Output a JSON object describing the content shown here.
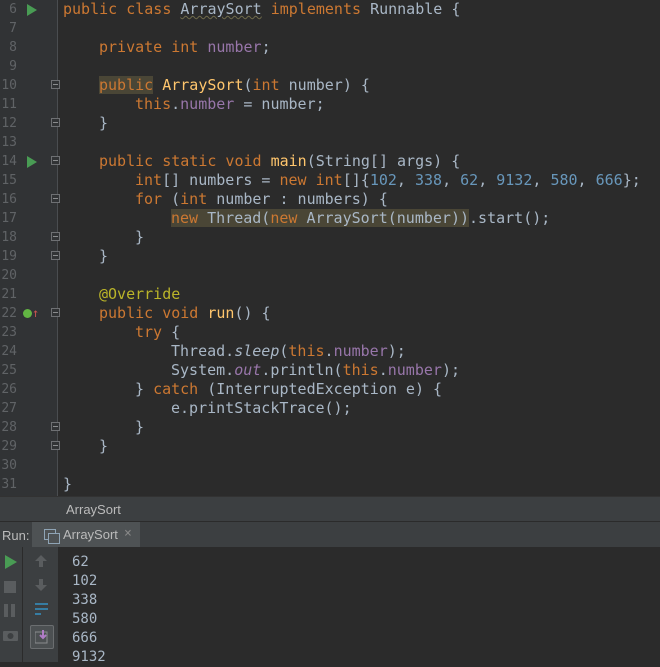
{
  "editor": {
    "lines": [
      {
        "n": "6",
        "indent": 0,
        "run": true,
        "tokens": [
          [
            "kw",
            "public class "
          ],
          [
            "cls",
            "ArraySort"
          ],
          [
            "kw",
            " implements "
          ],
          [
            "txt",
            "Runnable {"
          ]
        ]
      },
      {
        "n": "7",
        "indent": 0,
        "tokens": []
      },
      {
        "n": "8",
        "indent": 4,
        "tokens": [
          [
            "kw",
            "private int "
          ],
          [
            "fld",
            "number"
          ],
          [
            "txt",
            ";"
          ]
        ]
      },
      {
        "n": "9",
        "indent": 0,
        "tokens": []
      },
      {
        "n": "10",
        "indent": 4,
        "fold": true,
        "tokens": [
          [
            "kw",
            "public",
            "hl"
          ],
          [
            "txt",
            " "
          ],
          [
            "fn",
            "ArraySort"
          ],
          [
            "txt",
            "("
          ],
          [
            "kw",
            "int"
          ],
          [
            "txt",
            " number) {"
          ]
        ]
      },
      {
        "n": "11",
        "indent": 8,
        "tokens": [
          [
            "kw",
            "this"
          ],
          [
            "txt",
            "."
          ],
          [
            "fld",
            "number"
          ],
          [
            "txt",
            " = number;"
          ]
        ]
      },
      {
        "n": "12",
        "indent": 4,
        "fold": true,
        "tokens": [
          [
            "txt",
            "}"
          ]
        ]
      },
      {
        "n": "13",
        "indent": 0,
        "tokens": []
      },
      {
        "n": "14",
        "indent": 4,
        "run": true,
        "fold": true,
        "tokens": [
          [
            "kw",
            "public static void "
          ],
          [
            "fn",
            "main"
          ],
          [
            "txt",
            "(String[] args) {"
          ]
        ]
      },
      {
        "n": "15",
        "indent": 8,
        "tokens": [
          [
            "kw",
            "int"
          ],
          [
            "txt",
            "[] numbers = "
          ],
          [
            "kw",
            "new int"
          ],
          [
            "txt",
            "[]{"
          ],
          [
            "num",
            "102"
          ],
          [
            "txt",
            ", "
          ],
          [
            "num",
            "338"
          ],
          [
            "txt",
            ", "
          ],
          [
            "num",
            "62"
          ],
          [
            "txt",
            ", "
          ],
          [
            "num",
            "9132"
          ],
          [
            "txt",
            ", "
          ],
          [
            "num",
            "580"
          ],
          [
            "txt",
            ", "
          ],
          [
            "num",
            "666"
          ],
          [
            "txt",
            "};"
          ]
        ]
      },
      {
        "n": "16",
        "indent": 8,
        "fold": true,
        "tokens": [
          [
            "kw",
            "for"
          ],
          [
            "txt",
            " ("
          ],
          [
            "kw",
            "int"
          ],
          [
            "txt",
            " number : numbers) {"
          ]
        ]
      },
      {
        "n": "17",
        "indent": 12,
        "tokens": [
          [
            "kw",
            "new ",
            "hl"
          ],
          [
            "txt",
            "Thread(",
            "hl"
          ],
          [
            "kw",
            "new ",
            "hl"
          ],
          [
            "txt",
            "ArraySort(number))",
            "hl"
          ],
          [
            "txt",
            ".start();"
          ]
        ]
      },
      {
        "n": "18",
        "indent": 8,
        "fold": true,
        "tokens": [
          [
            "txt",
            "}"
          ]
        ]
      },
      {
        "n": "19",
        "indent": 4,
        "fold": true,
        "tokens": [
          [
            "txt",
            "}"
          ]
        ]
      },
      {
        "n": "20",
        "indent": 0,
        "tokens": []
      },
      {
        "n": "21",
        "indent": 4,
        "tokens": [
          [
            "ann",
            "@Override"
          ]
        ]
      },
      {
        "n": "22",
        "indent": 4,
        "override": true,
        "fold": true,
        "tokens": [
          [
            "kw",
            "public void "
          ],
          [
            "fn",
            "run"
          ],
          [
            "txt",
            "() {"
          ]
        ]
      },
      {
        "n": "23",
        "indent": 8,
        "tokens": [
          [
            "kw",
            "try"
          ],
          [
            "txt",
            " {"
          ]
        ]
      },
      {
        "n": "24",
        "indent": 12,
        "tokens": [
          [
            "txt",
            "Thread."
          ],
          [
            "it",
            "sleep"
          ],
          [
            "txt",
            "("
          ],
          [
            "kw",
            "this"
          ],
          [
            "txt",
            "."
          ],
          [
            "fld",
            "number"
          ],
          [
            "txt",
            ");"
          ]
        ]
      },
      {
        "n": "25",
        "indent": 12,
        "tokens": [
          [
            "txt",
            "System."
          ],
          [
            "itf",
            "out"
          ],
          [
            "txt",
            ".println("
          ],
          [
            "kw",
            "this"
          ],
          [
            "txt",
            "."
          ],
          [
            "fld",
            "number"
          ],
          [
            "txt",
            ");"
          ]
        ]
      },
      {
        "n": "26",
        "indent": 8,
        "tokens": [
          [
            "txt",
            "} "
          ],
          [
            "kw",
            "catch"
          ],
          [
            "txt",
            " (InterruptedException e) {"
          ]
        ]
      },
      {
        "n": "27",
        "indent": 12,
        "tokens": [
          [
            "txt",
            "e.printStackTrace();"
          ]
        ]
      },
      {
        "n": "28",
        "indent": 8,
        "fold": true,
        "tokens": [
          [
            "txt",
            "}"
          ]
        ]
      },
      {
        "n": "29",
        "indent": 4,
        "fold": true,
        "tokens": [
          [
            "txt",
            "}"
          ]
        ]
      },
      {
        "n": "30",
        "indent": 0,
        "tokens": []
      },
      {
        "n": "31",
        "indent": 0,
        "tokens": [
          [
            "txt",
            "}"
          ]
        ]
      }
    ]
  },
  "breadcrumb": "ArraySort",
  "run_panel": {
    "label": "Run:",
    "tab_label": "ArraySort",
    "close_glyph": "×",
    "output": [
      "62",
      "102",
      "338",
      "580",
      "666",
      "9132"
    ]
  }
}
